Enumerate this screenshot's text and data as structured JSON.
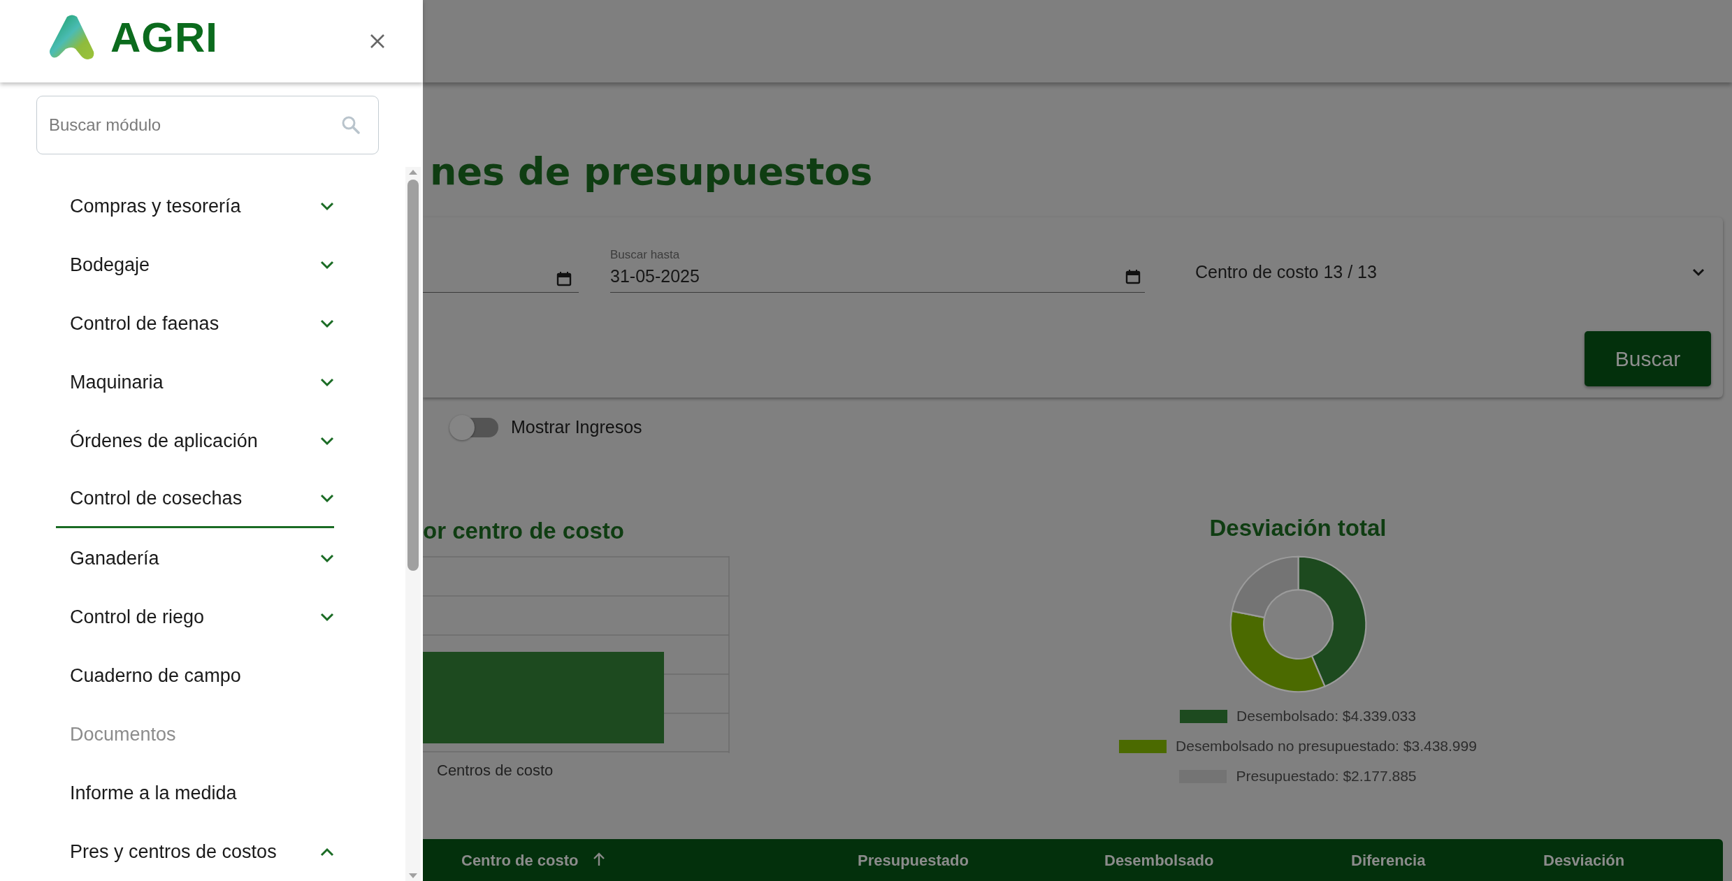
{
  "sidebar": {
    "logo_text": "AGRI",
    "search": {
      "placeholder": "Buscar módulo"
    },
    "items": [
      {
        "label": "Compras y tesorería",
        "kind": "group",
        "expanded": false,
        "selected": false,
        "disabled": false
      },
      {
        "label": "Bodegaje",
        "kind": "group",
        "expanded": false,
        "selected": false,
        "disabled": false
      },
      {
        "label": "Control de faenas",
        "kind": "group",
        "expanded": false,
        "selected": false,
        "disabled": false
      },
      {
        "label": "Maquinaria",
        "kind": "group",
        "expanded": false,
        "selected": false,
        "disabled": false
      },
      {
        "label": "Órdenes de aplicación",
        "kind": "group",
        "expanded": false,
        "selected": false,
        "disabled": false
      },
      {
        "label": "Control de cosechas",
        "kind": "group",
        "expanded": false,
        "selected": true,
        "disabled": false
      },
      {
        "label": "Ganadería",
        "kind": "group",
        "expanded": false,
        "selected": false,
        "disabled": false
      },
      {
        "label": "Control de riego",
        "kind": "group",
        "expanded": false,
        "selected": false,
        "disabled": false
      },
      {
        "label": "Cuaderno de campo",
        "kind": "link",
        "selected": false,
        "disabled": false
      },
      {
        "label": "Documentos",
        "kind": "link",
        "selected": false,
        "disabled": true
      },
      {
        "label": "Informe a la medida",
        "kind": "link",
        "selected": false,
        "disabled": false
      },
      {
        "label": "Pres y centros de costos",
        "kind": "group",
        "expanded": true,
        "selected": false,
        "disabled": false
      }
    ]
  },
  "main": {
    "title": "nes de presupuestos",
    "filters": {
      "date_to": {
        "label": "Buscar hasta",
        "value": "31-05-2025"
      },
      "cost_center": {
        "value": "Centro de costo 13 / 13"
      },
      "search_button": "Buscar"
    },
    "show_income": {
      "label": "Mostrar Ingresos",
      "on": false
    },
    "bar_chart": {
      "title": "or centro de costo",
      "xlabel": "Centros de costo"
    },
    "donut": {
      "chart_data": {
        "type": "donut",
        "title": "Desviación total",
        "categories": [
          "Desembolsado: $4.339.033",
          "Desembolsado no presupuestado: $3.438.999",
          "Presupuestado: $2.177.885"
        ],
        "values": [
          43.58,
          34.54,
          21.88
        ]
      },
      "legend": [
        {
          "color": "#1d4a1f"
        },
        {
          "color": "#4b6a00"
        },
        {
          "color": "#747474"
        }
      ]
    },
    "table": {
      "columns": [
        "Centro de costo",
        "Presupuestado",
        "Desembolsado",
        "Diferencia",
        "Desviación"
      ]
    }
  }
}
